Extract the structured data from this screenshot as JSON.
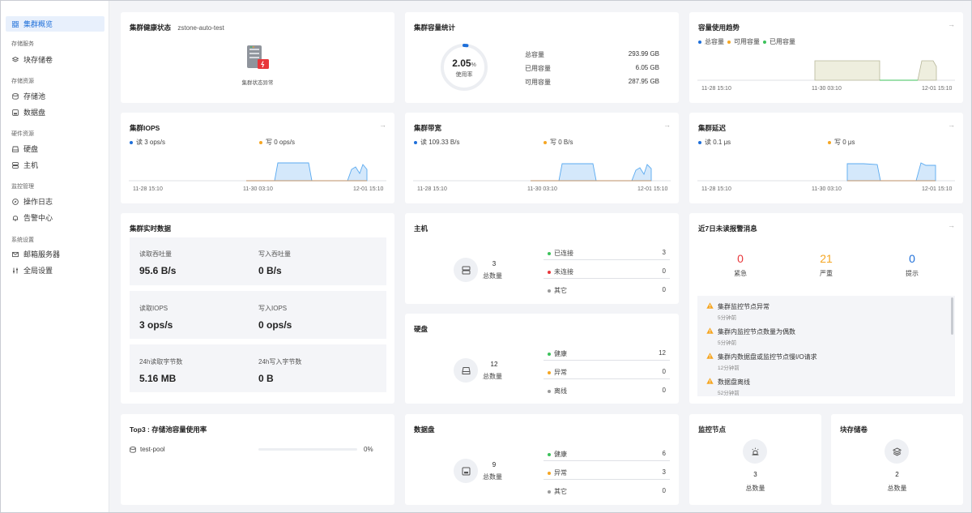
{
  "sidebar": {
    "active": "集群概览",
    "groups": [
      {
        "title": "存储服务",
        "items": [
          "块存储卷"
        ]
      },
      {
        "title": "存储资源",
        "items": [
          "存储池",
          "数据盘"
        ]
      },
      {
        "title": "硬件资源",
        "items": [
          "硬盘",
          "主机"
        ]
      },
      {
        "title": "监控管理",
        "items": [
          "操作日志",
          "告警中心"
        ]
      },
      {
        "title": "系统设置",
        "items": [
          "邮箱服务器",
          "全局设置"
        ]
      }
    ]
  },
  "health": {
    "title": "集群健康状态",
    "cluster_name": "zstone-auto-test",
    "status": "集群状态异常"
  },
  "capacity": {
    "title": "集群容量统计",
    "percent": "2.05",
    "percent_unit": "%",
    "usage_label": "使用率",
    "usage_fraction": 0.0205,
    "rows": [
      {
        "label": "总容量",
        "value": "293.99 GB"
      },
      {
        "label": "已用容量",
        "value": "6.05 GB"
      },
      {
        "label": "可用容量",
        "value": "287.95 GB"
      }
    ]
  },
  "trend": {
    "title": "容量使用趋势",
    "legend": [
      "总容量",
      "可用容量",
      "已用容量"
    ],
    "ticks": [
      "11-28 15:10",
      "11-30 03:10",
      "12-01 15:10"
    ]
  },
  "iops": {
    "title": "集群IOPS",
    "read": "读  3 ops/s",
    "write": "写  0 ops/s",
    "ticks": [
      "11-28 15:10",
      "11-30 03:10",
      "12-01 15:10"
    ]
  },
  "bandwidth": {
    "title": "集群带宽",
    "read": "读  109.33 B/s",
    "write": "写  0 B/s",
    "ticks": [
      "11-28 15:10",
      "11-30 03:10",
      "12-01 15:10"
    ]
  },
  "latency": {
    "title": "集群延迟",
    "read": "读  0.1 μs",
    "write": "写  0 μs",
    "ticks": [
      "11-28 15:10",
      "11-30 03:10",
      "12-01 15:10"
    ]
  },
  "realtime": {
    "title": "集群实时数据",
    "boxes": [
      {
        "l1": "读取吞吐量",
        "v1": "95.6 B/s",
        "l2": "写入吞吐量",
        "v2": "0 B/s"
      },
      {
        "l1": "读取IOPS",
        "v1": "3 ops/s",
        "l2": "写入IOPS",
        "v2": "0 ops/s"
      },
      {
        "l1": "24h读取字节数",
        "v1": "5.16 MB",
        "l2": "24h写入字节数",
        "v2": "0 B"
      }
    ]
  },
  "hosts": {
    "title": "主机",
    "count": "3",
    "count_label": "总数量",
    "rows": [
      {
        "label": "已连接",
        "value": "3",
        "color": "#3cc25b"
      },
      {
        "label": "未连接",
        "value": "0",
        "color": "#e8363a"
      },
      {
        "label": "其它",
        "value": "0",
        "color": "#9a9a9a"
      }
    ]
  },
  "disks": {
    "title": "硬盘",
    "count": "12",
    "count_label": "总数量",
    "rows": [
      {
        "label": "健康",
        "value": "12",
        "color": "#3cc25b"
      },
      {
        "label": "异常",
        "value": "0",
        "color": "#f5a623"
      },
      {
        "label": "离线",
        "value": "0",
        "color": "#9a9a9a"
      }
    ]
  },
  "datadisks": {
    "title": "数据盘",
    "count": "9",
    "count_label": "总数量",
    "rows": [
      {
        "label": "健康",
        "value": "6",
        "color": "#3cc25b"
      },
      {
        "label": "异常",
        "value": "3",
        "color": "#f5a623"
      },
      {
        "label": "其它",
        "value": "0",
        "color": "#9a9a9a"
      }
    ]
  },
  "alarms": {
    "title": "近7日未读报警消息",
    "counts": [
      {
        "value": "0",
        "label": "紧急",
        "color": "#e8363a"
      },
      {
        "value": "21",
        "label": "严重",
        "color": "#f5a623"
      },
      {
        "value": "0",
        "label": "提示",
        "color": "#1e6fd9"
      }
    ],
    "items": [
      {
        "text": "集群监控节点异常",
        "ago": "5分钟前"
      },
      {
        "text": "集群内监控节点数量为偶数",
        "ago": "5分钟前"
      },
      {
        "text": "集群内数据盘或监控节点慢I/O请求",
        "ago": "12分钟前"
      },
      {
        "text": "数据盘离线",
        "ago": "52分钟前"
      }
    ]
  },
  "top3": {
    "title": "Top3 : 存储池容量使用率",
    "pools": [
      {
        "name": "test-pool",
        "percent": "0%",
        "fraction": 0
      }
    ]
  },
  "monitor": {
    "title": "监控节点",
    "count": "3",
    "count_label": "总数量"
  },
  "volumes": {
    "title": "块存储卷",
    "count": "2",
    "count_label": "总数量"
  }
}
